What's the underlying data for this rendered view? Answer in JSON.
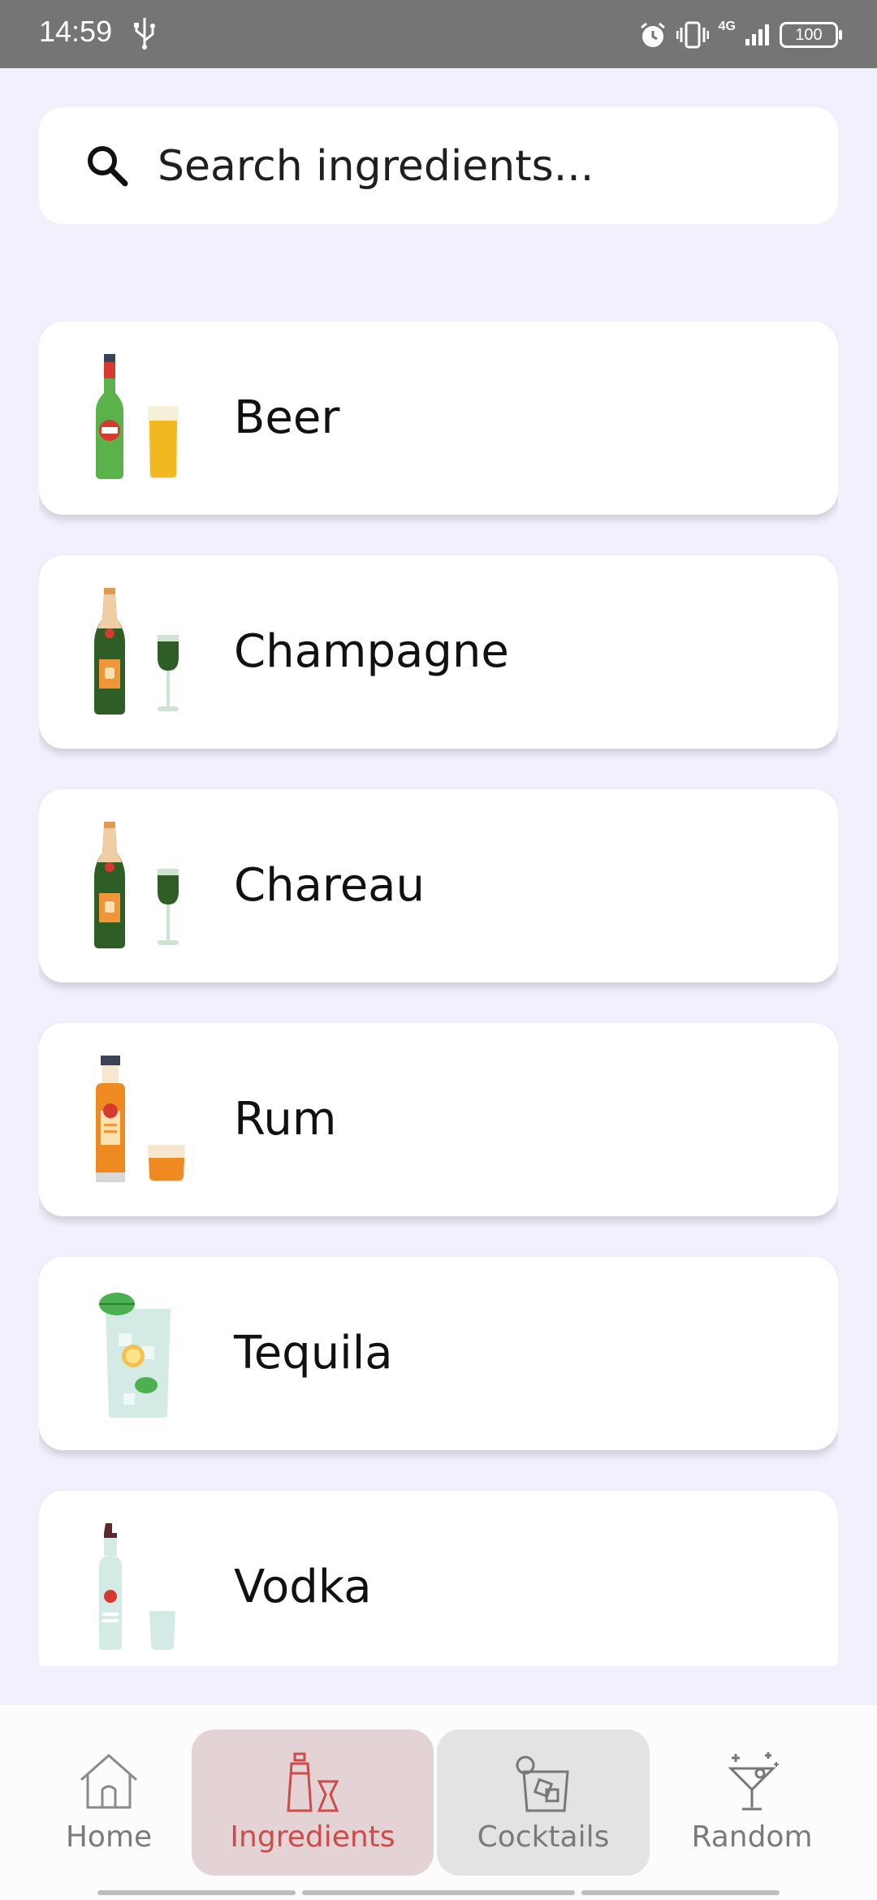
{
  "status_bar": {
    "time": "14:59",
    "network": "4G",
    "battery": "100",
    "icons": [
      "usb-icon",
      "alarm-icon",
      "vibrate-icon",
      "signal-icon",
      "battery-icon"
    ]
  },
  "search": {
    "placeholder": "Search ingredients...",
    "value": "",
    "icon": "search-icon"
  },
  "ingredients": [
    {
      "label": "Beer",
      "icon": "beer-bottle-glass-icon"
    },
    {
      "label": "Champagne",
      "icon": "champagne-bottle-glass-icon"
    },
    {
      "label": "Chareau",
      "icon": "chareau-bottle-glass-icon"
    },
    {
      "label": "Rum",
      "icon": "rum-bottle-glass-icon"
    },
    {
      "label": "Tequila",
      "icon": "tequila-glass-icon"
    },
    {
      "label": "Vodka",
      "icon": "vodka-bottle-glass-icon"
    }
  ],
  "nav": {
    "home": "Home",
    "ingredients": "Ingredients",
    "cocktails": "Cocktails",
    "random": "Random",
    "selected": "ingredients",
    "accent_color": "#cf4b4b"
  },
  "colors": {
    "background": "#f1f1fd",
    "status_bar": "#757575",
    "selected_tab_bg": "#e4d3d5"
  }
}
